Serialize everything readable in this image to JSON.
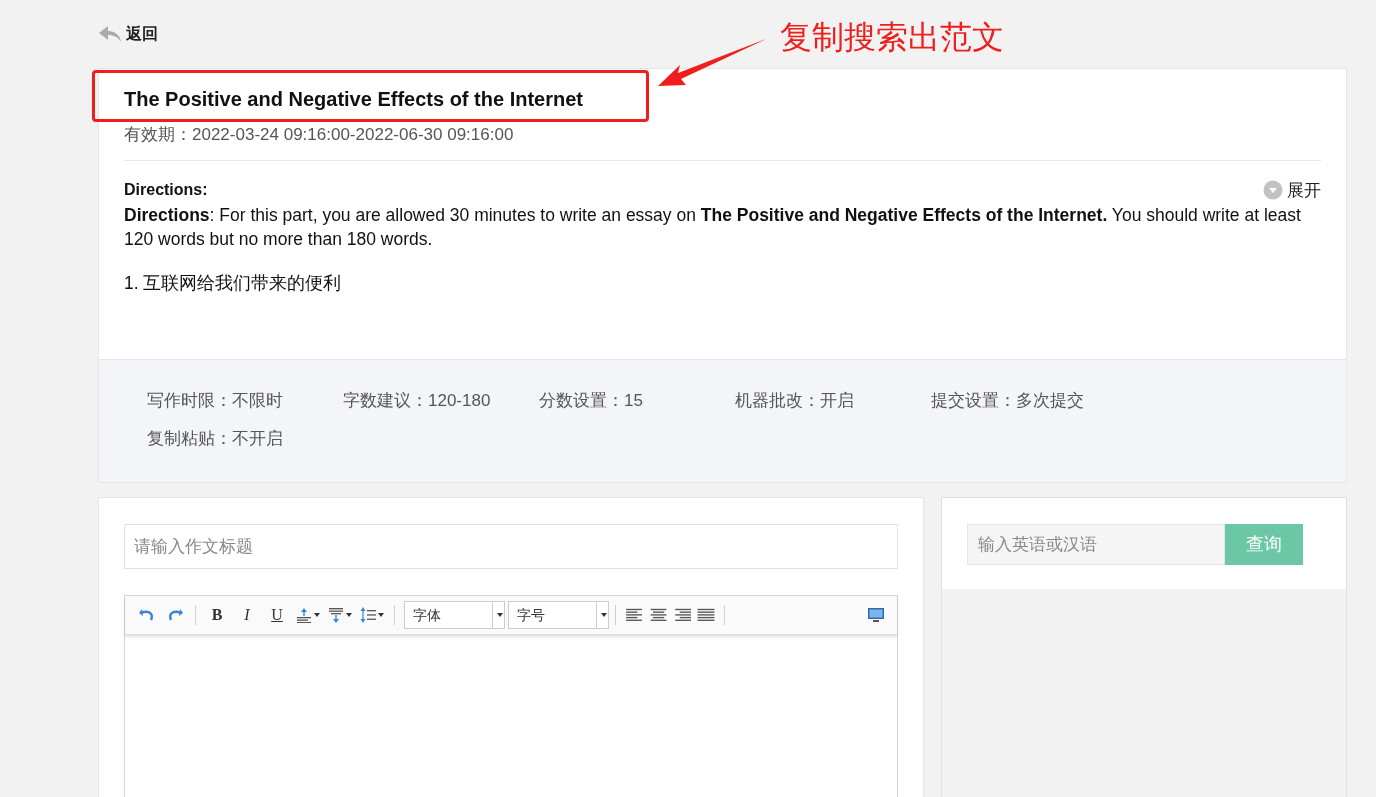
{
  "back_link": {
    "label": "返回"
  },
  "annotation": {
    "text": "复制搜索出范文"
  },
  "assignment": {
    "title": "The Positive and Negative Effects of the Internet",
    "validity": "有效期：2022-03-24 09:16:00-2022-06-30 09:16:00",
    "heading": "Directions:",
    "expand_toggle": {
      "label": "展开",
      "expanded": false
    },
    "paragraphs": [
      "**Directions**: For this part, you are allowed 30 minutes to write an essay on **The Positive and Negative Effects of the Internet.** You should write at least 120 words but no more than 180 words.",
      "1. 互联网给我们带来的便利"
    ]
  },
  "settings": [
    {
      "label": "写作时限：",
      "value": "不限时"
    },
    {
      "label": "字数建议：",
      "value": "120-180"
    },
    {
      "label": "分数设置：",
      "value": "15"
    },
    {
      "label": "机器批改：",
      "value": "开启"
    },
    {
      "label": "提交设置：",
      "value": "多次提交"
    },
    {
      "label": "复制粘贴：",
      "value": "不开启"
    }
  ],
  "editor": {
    "title_placeholder": "请输入作文标题",
    "toolbar": [
      {
        "kind": "undo"
      },
      {
        "kind": "redo"
      },
      {
        "kind": "sep"
      },
      {
        "kind": "bold",
        "text": "B"
      },
      {
        "kind": "italic",
        "text": "I"
      },
      {
        "kind": "underline",
        "text": "U"
      },
      {
        "kind": "forecolor"
      },
      {
        "kind": "valign"
      },
      {
        "kind": "lineheight"
      },
      {
        "kind": "sep"
      },
      {
        "kind": "select",
        "text": "字体"
      },
      {
        "kind": "select",
        "text": "字号"
      },
      {
        "kind": "sep"
      },
      {
        "kind": "align-left"
      },
      {
        "kind": "align-center"
      },
      {
        "kind": "align-right"
      },
      {
        "kind": "align-justify"
      },
      {
        "kind": "sep"
      },
      {
        "kind": "preview"
      }
    ]
  },
  "dictionary": {
    "placeholder": "输入英语或汉语",
    "button": "查询"
  }
}
